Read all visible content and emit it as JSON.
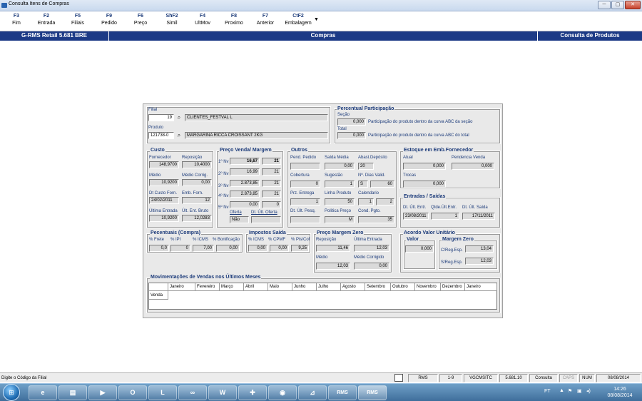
{
  "window": {
    "title": "Consulta Itens de Compras",
    "min": "─",
    "max": "▢",
    "close": "✕"
  },
  "fkeys": [
    {
      "key": "F3",
      "label": "Fim"
    },
    {
      "key": "F2",
      "label": "Entrada"
    },
    {
      "key": "F5",
      "label": "Filiais"
    },
    {
      "key": "F9",
      "label": "Pedido"
    },
    {
      "key": "F6",
      "label": "Preço"
    },
    {
      "key": "ShF2",
      "label": "Simil"
    },
    {
      "key": "F4",
      "label": "UltMov"
    },
    {
      "key": "F8",
      "label": "Proximo"
    },
    {
      "key": "F7",
      "label": "Anterior"
    },
    {
      "key": "CtF2",
      "label": "Embalagem"
    }
  ],
  "header": {
    "left": "G-RMS Retail 5.681 BRE",
    "center": "Compras",
    "right": "Consulta de Produtos"
  },
  "form": {
    "filial_label": "Filial",
    "filial_code": "19",
    "filial_name": "CLIENTES_FESTVAL L",
    "produto_label": "Produto",
    "produto_code": "121738-0",
    "produto_name": "MARGARINA RICCA CROISSANT 2KG",
    "pp_title": "Percentual Participação",
    "secao_label": "Seção",
    "secao_value": "0,000",
    "secao_text": "Participação do produto dentro da curva ABC da seção",
    "total_label": "Total",
    "total_value": "0,000",
    "total_text": "Participação do produto dentro da curva ABC do total",
    "custo": {
      "title": "Custo",
      "fornecedor_label": "Fornecedor",
      "fornecedor": "148,9700",
      "reposicao_label": "Reposição",
      "reposicao": "10,4000",
      "medio_label": "Médio",
      "medio": "10,9200",
      "medio_corrig_label": "Médio Corrig.",
      "medio_corrig": "0,00",
      "dt_custo_label": "Dt Custo Forn.",
      "dt_custo": "24/02/2011",
      "emb_forn_label": "Emb. Forn.",
      "emb_forn": "12",
      "ult_entrada_label": "Última Entrada",
      "ult_entrada": "10,9200",
      "ult_ent_bruto_label": "Últ. Ent. Bruto",
      "ult_ent_bruto": "12,0283"
    },
    "preco": {
      "title": "Preço Venda/ Margem",
      "rows": [
        {
          "label": "1º Nv",
          "price": "16,67",
          "qty": "21"
        },
        {
          "label": "2º Nv",
          "price": "16,99",
          "qty": "21"
        },
        {
          "label": "3º Nv",
          "price": "2.873,85",
          "qty": "21"
        },
        {
          "label": "4º Nv",
          "price": "2.873,85",
          "qty": "21"
        },
        {
          "label": "5º Nv",
          "price": "0,00",
          "qty": "0"
        }
      ],
      "oferta_label": "Oferta",
      "oferta": "Não",
      "dt_ult_oferta_label": "Dt. Últ. Oferta",
      "dt_ult_oferta": ""
    },
    "outros": {
      "title": "Outros",
      "pend_pedido_label": "Pend. Pedido",
      "pend_pedido": "",
      "saida_media_label": "Saída Média",
      "saida_media": "0,00",
      "abast_label": "Abast.Depósito",
      "abast": "20",
      "cobertura_label": "Cobertura",
      "cobertura": "0",
      "sugestao_label": "Sugestão",
      "sugestao": "1",
      "dias_valid_label": "Nº. Dias Valid.",
      "dias_valid_flag": "S",
      "dias_valid": "60",
      "prz_entrega_label": "Prz. Entrega",
      "prz_entrega": "1",
      "linha_produto_label": "Linha Produto",
      "linha_produto": "50",
      "calendario_label": "Calendario",
      "calendario_a": "1",
      "calendario_b": "2",
      "dt_ult_pesq_label": "Dt. Últ. Pesq.",
      "dt_ult_pesq": "",
      "politica_label": "Política Preço",
      "politica": "M",
      "cond_pgto_label": "Cond. Pgto.",
      "cond_pgto": "35"
    },
    "estoque": {
      "title": "Estoque em Emb.Fornecedor",
      "atual_label": "Atual",
      "atual": "0,000",
      "pendencia_label": "Pendencia Venda",
      "pendencia": "0,000",
      "trocas_label": "Trocas",
      "trocas": "0,000"
    },
    "entradas": {
      "title": "Entradas / Saídas",
      "dt_ult_entr_label": "Dt. Últ. Entr.",
      "dt_ult_entr": "23/08/2011",
      "qtde_label": "Qtde.Últ.Entr.",
      "qtde": "1",
      "dt_ult_saida_label": "Dt. Últ. Saída",
      "dt_ult_saida": "17/11/2011"
    },
    "percentuais": {
      "title": "Pecentuais (Compra)",
      "frete_label": "% Frete",
      "frete": "0,0",
      "ipi_label": "% IPI",
      "ipi": "0",
      "icms_label": "% ICMS",
      "icms": "7,00",
      "bonif_label": "% Bonificação",
      "bonif": "0,00"
    },
    "impostos": {
      "title": "Impostos Saída",
      "icms_label": "% ICMS",
      "icms": "0,00",
      "cpmf_label": "% CPMF",
      "cpmf": "0,00",
      "pis_label": "% Pis/Cof",
      "pis": "9,25"
    },
    "margem_zero": {
      "title": "Preço Margem Zero",
      "reposicao_label": "Reposição",
      "reposicao": "11,46",
      "ult_entrada_label": "Última Entrada",
      "ult_entrada": "12,03",
      "medio_label": "Médio",
      "medio": "12,03",
      "medio_corrig_label": "Médio Corrigido",
      "medio_corrig": "0,00"
    },
    "acordo": {
      "title": "Acordo Valor Unitário",
      "valor_title": "Valor",
      "valor": "0,000",
      "margem_title": "Margem Zero",
      "creg_label": "C/Reg.Esp.",
      "creg": "13,04",
      "sreg_label": "S/Reg.Esp.",
      "sreg": "12,03"
    },
    "movimentacoes": {
      "title": "Movimentações de Vendas nos Últimos Meses",
      "months": [
        "Janeiro",
        "Fevereiro",
        "Março",
        "Abril",
        "Maio",
        "Junho",
        "Julho",
        "Agosto",
        "Setembro",
        "Outubro",
        "Novembro",
        "Dezembro",
        "Janeiro"
      ],
      "row_label": "Venda"
    }
  },
  "status": {
    "message": "Digite o Código da Filial",
    "app": "RMS",
    "page": "1-9",
    "server": "VGCMSITC",
    "version": "5.681.10",
    "mode": "Consulta",
    "caps": "CAPS",
    "num": "NUM",
    "date": "08/08/2014"
  },
  "taskbar": {
    "lang": "FT",
    "time": "14:26",
    "date": "08/08/2014",
    "pins": [
      {
        "name": "ie",
        "glyph": "e"
      },
      {
        "name": "explorer",
        "glyph": "▤"
      },
      {
        "name": "media",
        "glyph": "▶"
      },
      {
        "name": "outlook",
        "glyph": "O"
      },
      {
        "name": "lync",
        "glyph": "L"
      },
      {
        "name": "app-oo",
        "glyph": "∞"
      },
      {
        "name": "word",
        "glyph": "W"
      },
      {
        "name": "app-cross",
        "glyph": "✚"
      },
      {
        "name": "app-globe",
        "glyph": "◉"
      },
      {
        "name": "pdf",
        "glyph": "⊿"
      },
      {
        "name": "rms1",
        "glyph": "RMS"
      },
      {
        "name": "rms2",
        "glyph": "RMS"
      }
    ]
  }
}
